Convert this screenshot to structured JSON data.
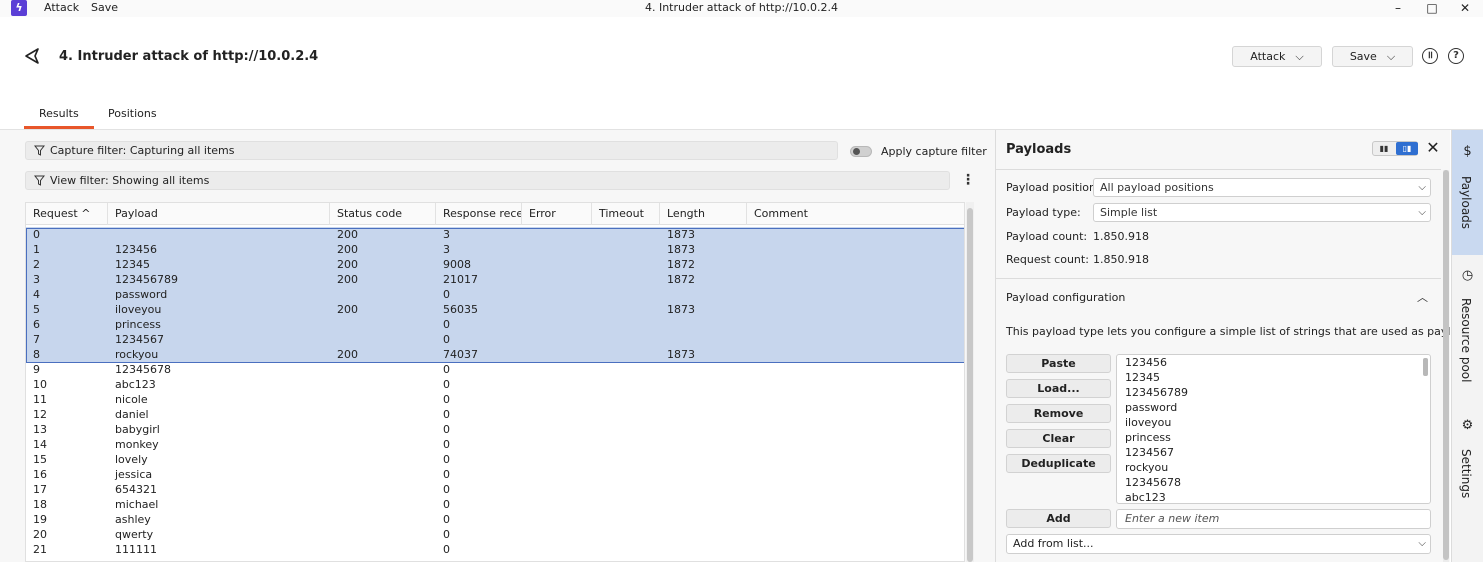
{
  "titlebar": {
    "menu": [
      "Attack",
      "Save"
    ],
    "window_title": "4. Intruder attack of http://10.0.2.4",
    "logo_icon": "burp-logo-icon",
    "controls": [
      "minimize-icon",
      "maximize-icon",
      "close-icon"
    ]
  },
  "header": {
    "title": "4. Intruder attack of http://10.0.2.4",
    "attack_label": "Attack",
    "save_label": "Save"
  },
  "tabs": [
    {
      "label": "Results",
      "active": true
    },
    {
      "label": "Positions",
      "active": false
    }
  ],
  "filters": {
    "capture": "Capture filter: Capturing all items",
    "apply_capture": "Apply capture filter",
    "view": "View filter: Showing all items"
  },
  "table": {
    "columns": [
      "Request",
      "Payload",
      "Status code",
      "Response rece...",
      "Error",
      "Timeout",
      "Length",
      "Comment"
    ],
    "sort": {
      "column": "Request",
      "direction": "ascending"
    },
    "rows": [
      {
        "request": "0",
        "payload": "",
        "status": "200",
        "response": "3",
        "length": "1873",
        "selected": true
      },
      {
        "request": "1",
        "payload": "123456",
        "status": "200",
        "response": "3",
        "length": "1873",
        "selected": true
      },
      {
        "request": "2",
        "payload": "12345",
        "status": "200",
        "response": "9008",
        "length": "1872",
        "selected": true
      },
      {
        "request": "3",
        "payload": "123456789",
        "status": "200",
        "response": "21017",
        "length": "1872",
        "selected": true
      },
      {
        "request": "4",
        "payload": "password",
        "status": "",
        "response": "0",
        "length": "",
        "selected": true
      },
      {
        "request": "5",
        "payload": "iloveyou",
        "status": "200",
        "response": "56035",
        "length": "1873",
        "selected": true
      },
      {
        "request": "6",
        "payload": "princess",
        "status": "",
        "response": "0",
        "length": "",
        "selected": true
      },
      {
        "request": "7",
        "payload": "1234567",
        "status": "",
        "response": "0",
        "length": "",
        "selected": true
      },
      {
        "request": "8",
        "payload": "rockyou",
        "status": "200",
        "response": "74037",
        "length": "1873",
        "selected": true
      },
      {
        "request": "9",
        "payload": "12345678",
        "status": "",
        "response": "0",
        "length": "",
        "selected": false
      },
      {
        "request": "10",
        "payload": "abc123",
        "status": "",
        "response": "0",
        "length": "",
        "selected": false
      },
      {
        "request": "11",
        "payload": "nicole",
        "status": "",
        "response": "0",
        "length": "",
        "selected": false
      },
      {
        "request": "12",
        "payload": "daniel",
        "status": "",
        "response": "0",
        "length": "",
        "selected": false
      },
      {
        "request": "13",
        "payload": "babygirl",
        "status": "",
        "response": "0",
        "length": "",
        "selected": false
      },
      {
        "request": "14",
        "payload": "monkey",
        "status": "",
        "response": "0",
        "length": "",
        "selected": false
      },
      {
        "request": "15",
        "payload": "lovely",
        "status": "",
        "response": "0",
        "length": "",
        "selected": false
      },
      {
        "request": "16",
        "payload": "jessica",
        "status": "",
        "response": "0",
        "length": "",
        "selected": false
      },
      {
        "request": "17",
        "payload": "654321",
        "status": "",
        "response": "0",
        "length": "",
        "selected": false
      },
      {
        "request": "18",
        "payload": "michael",
        "status": "",
        "response": "0",
        "length": "",
        "selected": false
      },
      {
        "request": "19",
        "payload": "ashley",
        "status": "",
        "response": "0",
        "length": "",
        "selected": false
      },
      {
        "request": "20",
        "payload": "qwerty",
        "status": "",
        "response": "0",
        "length": "",
        "selected": false
      },
      {
        "request": "21",
        "payload": "111111",
        "status": "",
        "response": "0",
        "length": "",
        "selected": false
      }
    ]
  },
  "payloads_panel": {
    "title": "Payloads",
    "position_label": "Payload position:",
    "position_value": "All payload positions",
    "type_label": "Payload type:",
    "type_value": "Simple list",
    "count_label": "Payload count:",
    "count_value": "1.850.918",
    "request_label": "Request count:",
    "request_value": "1.850.918",
    "config_title": "Payload configuration",
    "config_desc": "This payload type lets you configure a simple list of strings that are used as payloads.",
    "buttons": [
      "Paste",
      "Load...",
      "Remove",
      "Clear",
      "Deduplicate"
    ],
    "list": [
      "123456",
      "12345",
      "123456789",
      "password",
      "iloveyou",
      "princess",
      "1234567",
      "rockyou",
      "12345678",
      "abc123"
    ],
    "add_label": "Add",
    "add_placeholder": "Enter a new item",
    "add_from_list": "Add from list..."
  },
  "side_tabs": [
    {
      "label": "Payloads",
      "icon": "dollar-icon",
      "active": true
    },
    {
      "label": "Resource pool",
      "icon": "clock-icon",
      "active": false
    },
    {
      "label": "Settings",
      "icon": "gear-icon",
      "active": false
    }
  ],
  "colors": {
    "accent": "#e8562a",
    "selection": "#c7d6ed",
    "toggle_active": "#2f6fd1",
    "logo": "#5b3fd6"
  }
}
